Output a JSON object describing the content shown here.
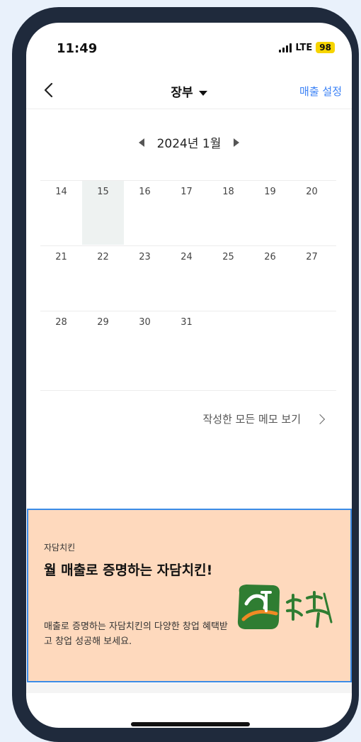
{
  "status_bar": {
    "time": "11:49",
    "network": "LTE",
    "battery": "98"
  },
  "nav": {
    "title": "장부",
    "action": "매출 설정",
    "back_icon": "chevron-left-icon",
    "title_icon": "caret-down-icon"
  },
  "calendar": {
    "month_label": "2024년 1월",
    "prev_icon": "triangle-left-icon",
    "next_icon": "triangle-right-icon",
    "today": "15",
    "weeks": [
      [
        "14",
        "15",
        "16",
        "17",
        "18",
        "19",
        "20"
      ],
      [
        "21",
        "22",
        "23",
        "24",
        "25",
        "26",
        "27"
      ],
      [
        "28",
        "29",
        "30",
        "31",
        "",
        "",
        ""
      ]
    ]
  },
  "memo_link": "작성한 모든 메모 보기",
  "ad": {
    "brand": "자담치킨",
    "headline": "월 매출로 증명하는 자담치킨!",
    "description": "매출로 증명하는 자담치킨의 다양한 창업 혜택받고 창업 성공해 보세요.",
    "logo_text": "자담치킨",
    "background": "#fed9bd"
  },
  "colors": {
    "accent": "#3b82f6",
    "frame": "#1f2a3c",
    "battery": "#f6d400"
  }
}
